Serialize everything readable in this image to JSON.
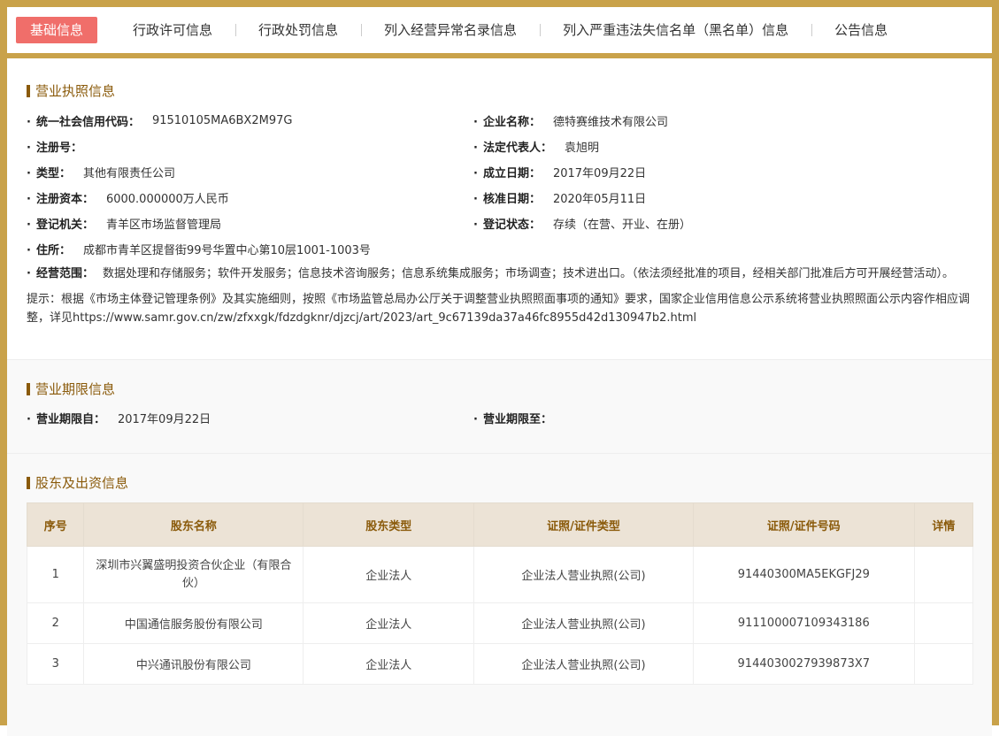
{
  "tabs": [
    {
      "label": "基础信息",
      "active": true
    },
    {
      "label": "行政许可信息"
    },
    {
      "label": "行政处罚信息"
    },
    {
      "label": "列入经营异常名录信息"
    },
    {
      "label": "列入严重违法失信名单（黑名单）信息"
    },
    {
      "label": "公告信息"
    }
  ],
  "license": {
    "title": "营业执照信息",
    "fields": [
      {
        "label": "统一社会信用代码：",
        "value": "91510105MA6BX2M97G"
      },
      {
        "label": "企业名称：",
        "value": "德特赛维技术有限公司"
      },
      {
        "label": "注册号：",
        "value": ""
      },
      {
        "label": "法定代表人：",
        "value": "袁旭明"
      },
      {
        "label": "类型：",
        "value": "其他有限责任公司"
      },
      {
        "label": "成立日期：",
        "value": "2017年09月22日"
      },
      {
        "label": "注册资本：",
        "value": "6000.000000万人民币"
      },
      {
        "label": "核准日期：",
        "value": "2020年05月11日"
      },
      {
        "label": "登记机关：",
        "value": "青羊区市场监督管理局"
      },
      {
        "label": "登记状态：",
        "value": "存续（在营、开业、在册）"
      }
    ],
    "address": {
      "label": "住所：",
      "value": "成都市青羊区提督街99号华置中心第10层1001-1003号"
    },
    "scope": {
      "label": "经营范围：",
      "value": "数据处理和存储服务；软件开发服务；信息技术咨询服务；信息系统集成服务；市场调查；技术进出口。（依法须经批准的项目，经相关部门批准后方可开展经营活动）。"
    },
    "notice": "提示：根据《市场主体登记管理条例》及其实施细则，按照《市场监管总局办公厅关于调整营业执照照面事项的通知》要求，国家企业信用信息公示系统将营业执照照面公示内容作相应调整，详见https://www.samr.gov.cn/zw/zfxxgk/fdzdgknr/djzcj/art/2023/art_9c67139da37a46fc8955d42d130947b2.html"
  },
  "term": {
    "title": "营业期限信息",
    "from": {
      "label": "营业期限自：",
      "value": "2017年09月22日"
    },
    "to": {
      "label": "营业期限至：",
      "value": ""
    }
  },
  "shareholders": {
    "title": "股东及出资信息",
    "headers": [
      "序号",
      "股东名称",
      "股东类型",
      "证照/证件类型",
      "证照/证件号码",
      "详情"
    ],
    "rows": [
      [
        "1",
        "深圳市兴翼盛明投资合伙企业（有限合伙）",
        "企业法人",
        "企业法人营业执照(公司)",
        "91440300MA5EKGFJ29",
        ""
      ],
      [
        "2",
        "中国通信服务股份有限公司",
        "企业法人",
        "企业法人营业执照(公司)",
        "911100007109343186",
        ""
      ],
      [
        "3",
        "中兴通讯股份有限公司",
        "企业法人",
        "企业法人营业执照(公司)",
        "9144030027939873X7",
        ""
      ]
    ]
  }
}
